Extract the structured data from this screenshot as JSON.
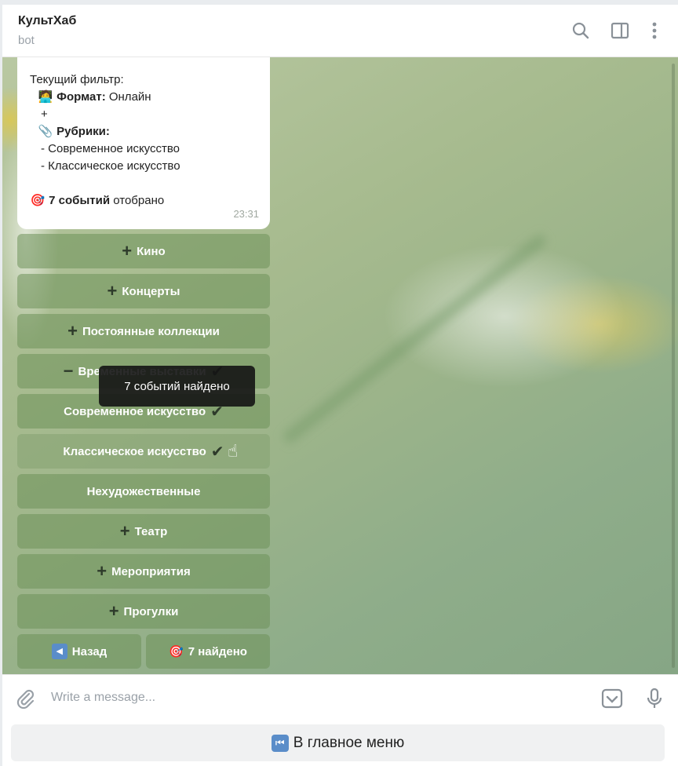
{
  "header": {
    "title": "КультХаб",
    "subtitle": "bot",
    "icons": [
      "search-icon",
      "sidebar-toggle-icon",
      "more-vertical-icon"
    ]
  },
  "message": {
    "filter_label": "Текущий фильтр:",
    "format_emoji": "🧑‍💻",
    "format_label": "Формат:",
    "format_value": "Онлайн",
    "plus": "+",
    "rubrics_emoji": "📎",
    "rubrics_label": "Рубрики:",
    "rubric_1": "- Современное искусство",
    "rubric_2": "- Классическое искусство",
    "count_emoji": "🎯",
    "count_bold": "7 событий",
    "count_rest": "отобрано",
    "time": "23:31"
  },
  "keyboard": {
    "cinema": "Кино",
    "concerts": "Концерты",
    "permanent": "Постоянные коллекции",
    "temporary": "Временные выставки",
    "modern": "Современное искусство",
    "classic": "Классическое искусство",
    "nonart": "Нехудожественные",
    "theater": "Театр",
    "events": "Мероприятия",
    "walks": "Прогулки",
    "back": "Назад",
    "found": "7 найдено",
    "plus_sign": "➕",
    "minus_sign": "➖",
    "check_sign": "✔"
  },
  "tooltip": "7 событий найдено",
  "composer": {
    "placeholder": "Write a message..."
  },
  "reply_keyboard": {
    "main_menu": "В главное меню"
  },
  "colors": {
    "accent": "#5a8dc9",
    "button_bg": "#6e915a"
  }
}
